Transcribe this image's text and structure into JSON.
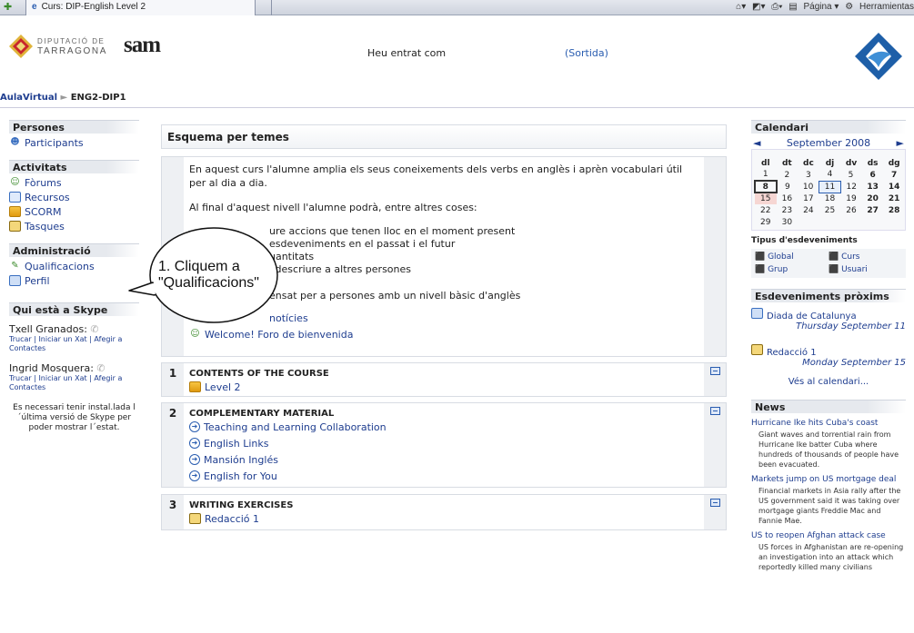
{
  "browser": {
    "tab_title": "Curs: DIP-English Level 2",
    "tools": [
      "Página",
      "Herramientas"
    ]
  },
  "header": {
    "logo_dip": {
      "line1": "DIPUTACIÓ DE",
      "line2": "TARRAGONA"
    },
    "logo_sam": "SAM",
    "logged_in_text": "Heu entrat com",
    "logout_text": "(Sortida)"
  },
  "breadcrumb": {
    "root": "AulaVirtual",
    "sep": "►",
    "course": "ENG2-DIP1"
  },
  "left": {
    "persones": {
      "title": "Persones",
      "items": [
        {
          "label": "Participants"
        }
      ]
    },
    "activitats": {
      "title": "Activitats",
      "items": [
        {
          "label": "Fòrums"
        },
        {
          "label": "Recursos"
        },
        {
          "label": "SCORM"
        },
        {
          "label": "Tasques"
        }
      ]
    },
    "admin": {
      "title": "Administració",
      "items": [
        {
          "label": "Qualificacions"
        },
        {
          "label": "Perfil"
        }
      ]
    },
    "skype": {
      "title": "Qui està a Skype",
      "users": [
        {
          "name": "Txell Granados:",
          "links": "Trucar | Iniciar un Xat | Afegir a Contactes"
        },
        {
          "name": "Ingrid Mosquera:",
          "links": "Trucar | Iniciar un Xat | Afegir a Contactes"
        }
      ],
      "note": "Es necessari tenir instal.lada l´última versió de Skype per poder mostrar l´estat."
    }
  },
  "center": {
    "title": "Esquema per temes",
    "intro": {
      "p1": "En aquest curs l'alumne amplia els seus coneixements dels verbs en anglès i aprèn vocabulari útil per al dia a dia.",
      "p2": "Al final d'aquest nivell l'alumne podrà, entre altres coses:",
      "bullets": [
        "ure accions que tenen lloc en el moment present",
        "esdeveniments en el passat i el futur",
        "uantitats",
        "i descriure a altres persones"
      ],
      "p3": "ensat per a persones amb un nivell bàsic d'anglès",
      "news_link": "notícies",
      "forum_link": "Welcome! Foro de bienvenida"
    },
    "sections": [
      {
        "num": "1",
        "title": "CONTENTS OF THE COURSE",
        "items": [
          "Level 2"
        ]
      },
      {
        "num": "2",
        "title": "COMPLEMENTARY MATERIAL",
        "items": [
          "Teaching and Learning Collaboration",
          "English Links",
          "Mansión Inglés",
          "English for You"
        ]
      },
      {
        "num": "3",
        "title": "WRITING EXERCISES",
        "items": [
          "Redacció 1"
        ]
      }
    ]
  },
  "callout": {
    "text": "1. Cliquem a \"Qualificacions\""
  },
  "right": {
    "calendar": {
      "title": "Calendari",
      "prev": "◄",
      "month": "September 2008",
      "next": "►",
      "days": [
        "dl",
        "dt",
        "dc",
        "dj",
        "dv",
        "ds",
        "dg"
      ],
      "weeks": [
        [
          "1",
          "2",
          "3",
          "4",
          "5",
          "6",
          "7"
        ],
        [
          "8",
          "9",
          "10",
          "11",
          "12",
          "13",
          "14"
        ],
        [
          "15",
          "16",
          "17",
          "18",
          "19",
          "20",
          "21"
        ],
        [
          "22",
          "23",
          "24",
          "25",
          "26",
          "27",
          "28"
        ],
        [
          "29",
          "30",
          "",
          "",
          "",
          "",
          ""
        ]
      ],
      "event_types_title": "Tipus d'esdeveniments",
      "event_types": [
        "Global",
        "Curs",
        "Grup",
        "Usuari"
      ]
    },
    "upcoming": {
      "title": "Esdeveniments pròxims",
      "events": [
        {
          "name": "Diada de Catalunya",
          "date": "Thursday September 11"
        },
        {
          "name": "Redacció 1",
          "date": "Monday September 15"
        }
      ],
      "more": "Vés al calendari..."
    },
    "news": {
      "title": "News",
      "items": [
        {
          "head": "Hurricane Ike hits Cuba's coast",
          "body": "Giant waves and torrential rain from Hurricane Ike batter Cuba where hundreds of thousands of people have been evacuated."
        },
        {
          "head": "Markets jump on US mortgage deal",
          "body": "Financial markets in Asia rally after the US government said it was taking over mortgage giants Freddie Mac and Fannie Mae."
        },
        {
          "head": "US to reopen Afghan attack case",
          "body": "US forces in Afghanistan are re-opening an investigation into an attack which reportedly killed many civilians"
        }
      ]
    }
  }
}
